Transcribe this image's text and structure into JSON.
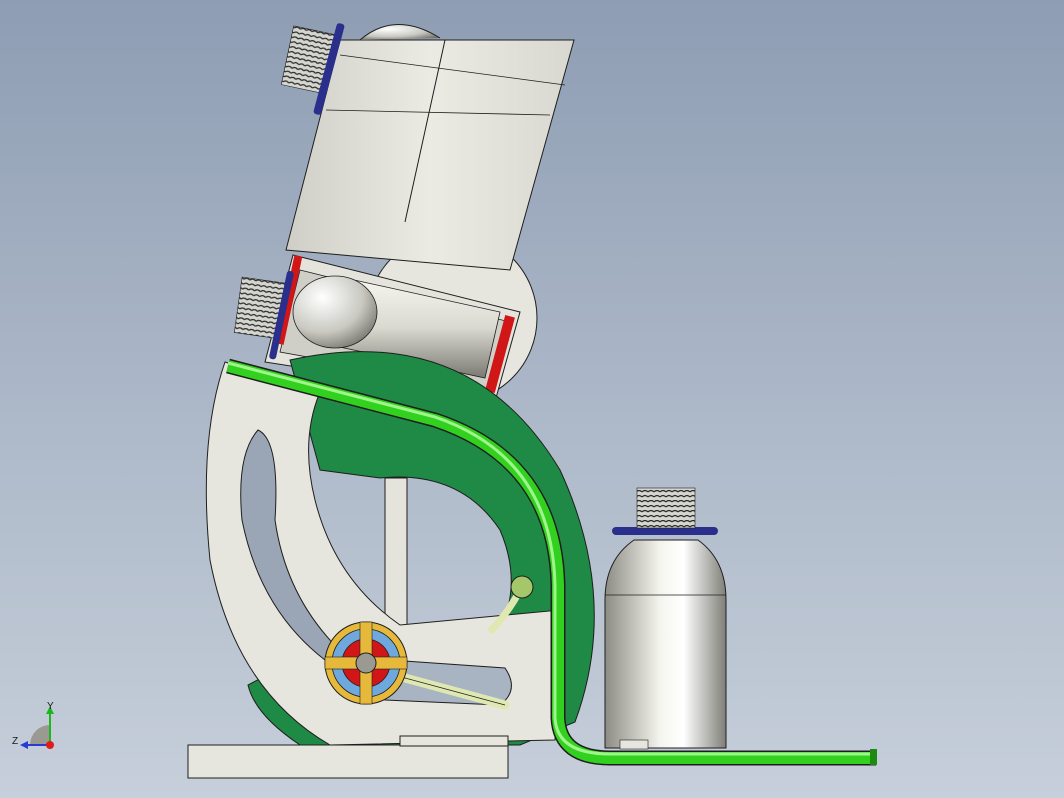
{
  "view": {
    "background_top": "#8e9db3",
    "background_bottom": "#c6cfda"
  },
  "colors": {
    "body": "#e4e3dc",
    "body_stroke": "#1e1e1e",
    "green_part": "#1f8a45",
    "tube": "#33d11f",
    "tube_dark": "#1f8a12",
    "bottle_light": "#f4f4ee",
    "bottle_dark": "#8c8c84",
    "seal_ring": "#2b2f8c",
    "red_part": "#d01616",
    "yellow_part": "#e7b93a",
    "blue_part": "#6fa8dc"
  },
  "triad": {
    "x_label": "",
    "y_label": "Y",
    "z_label": "Z"
  }
}
